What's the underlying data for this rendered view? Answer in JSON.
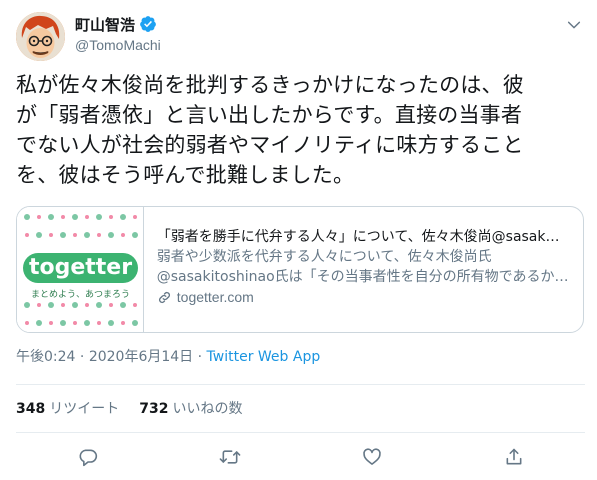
{
  "author": {
    "display_name": "町山智浩",
    "handle": "@TomoMachi",
    "verified": true
  },
  "tweet": {
    "lines": [
      "私が佐々木俊尚を批判するきっかけになったのは、彼",
      "が「弱者憑依」と言い出したからです。直接の当事者",
      "でない人が社会的弱者やマイノリティに味方すること",
      "を、彼はそう呼んで批難しました。"
    ]
  },
  "card": {
    "thumb_logo": "togetter",
    "thumb_tagline": "まとめよう、あつまろう",
    "title": "「弱者を勝手に代弁する人々」について、佐々木俊尚@sasak…",
    "desc_line1": "弱者や少数派を代弁する人々について、佐々木俊尚氏",
    "desc_line2": "@sasakitoshinao氏は「その当事者性を自分の所有物であるか…",
    "domain": "togetter.com"
  },
  "meta": {
    "time": "午後0:24",
    "sep": " · ",
    "date": "2020年6月14日",
    "sep2": " · ",
    "source": "Twitter Web App"
  },
  "stats": {
    "retweets_count": "348",
    "retweets_label": "リツイート",
    "likes_count": "732",
    "likes_label": "いいねの数"
  },
  "icons": {
    "caret": "chevron-down-icon",
    "reply": "reply-icon",
    "retweet": "retweet-icon",
    "like": "heart-icon",
    "share": "share-icon",
    "link": "link-icon"
  },
  "colors": {
    "accent": "#1da1f2",
    "muted": "#657786",
    "border": "#ccd6dd",
    "togetter_green": "#3cb371"
  }
}
